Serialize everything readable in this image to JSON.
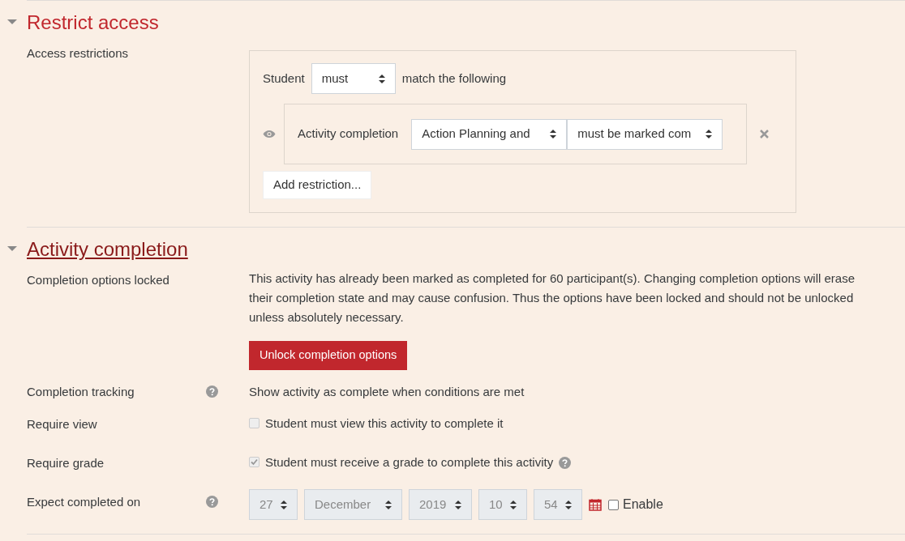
{
  "restrict_access": {
    "title": "Restrict access",
    "expanded": true,
    "focused": false,
    "label": "Access restrictions",
    "match": {
      "prefix": "Student",
      "value": "must",
      "suffix": "match the following"
    },
    "conditions": [
      {
        "visible": true,
        "type": "Activity completion",
        "activity": "Action Planning and",
        "requirement": "must be marked com"
      }
    ],
    "add_button": "Add restriction..."
  },
  "activity_completion": {
    "title": "Activity completion",
    "expanded": true,
    "focused": true,
    "rows": [
      {
        "kind": "locked",
        "label": "Completion options locked",
        "text": "This activity has already been marked as completed for 60 participant(s). Changing completion options will erase their completion state and may cause confusion. Thus the options have been locked and should not be unlocked unless absolutely necessary.",
        "button": "Unlock completion options"
      },
      {
        "kind": "text",
        "label": "Completion tracking",
        "help": true,
        "text": "Show activity as complete when conditions are met"
      },
      {
        "kind": "checkbox",
        "label": "Require view",
        "checked": false,
        "disabled": true,
        "text": "Student must view this activity to complete it",
        "text_help": false
      },
      {
        "kind": "checkbox",
        "label": "Require grade",
        "checked": true,
        "disabled": true,
        "text": "Student must receive a grade to complete this activity",
        "text_help": true
      },
      {
        "kind": "date",
        "label": "Expect completed on",
        "help": true,
        "disabled": true,
        "fields": [
          "27",
          "December",
          "2019",
          "10",
          "54"
        ],
        "enable": {
          "label": "Enable",
          "checked": false
        }
      }
    ]
  }
}
